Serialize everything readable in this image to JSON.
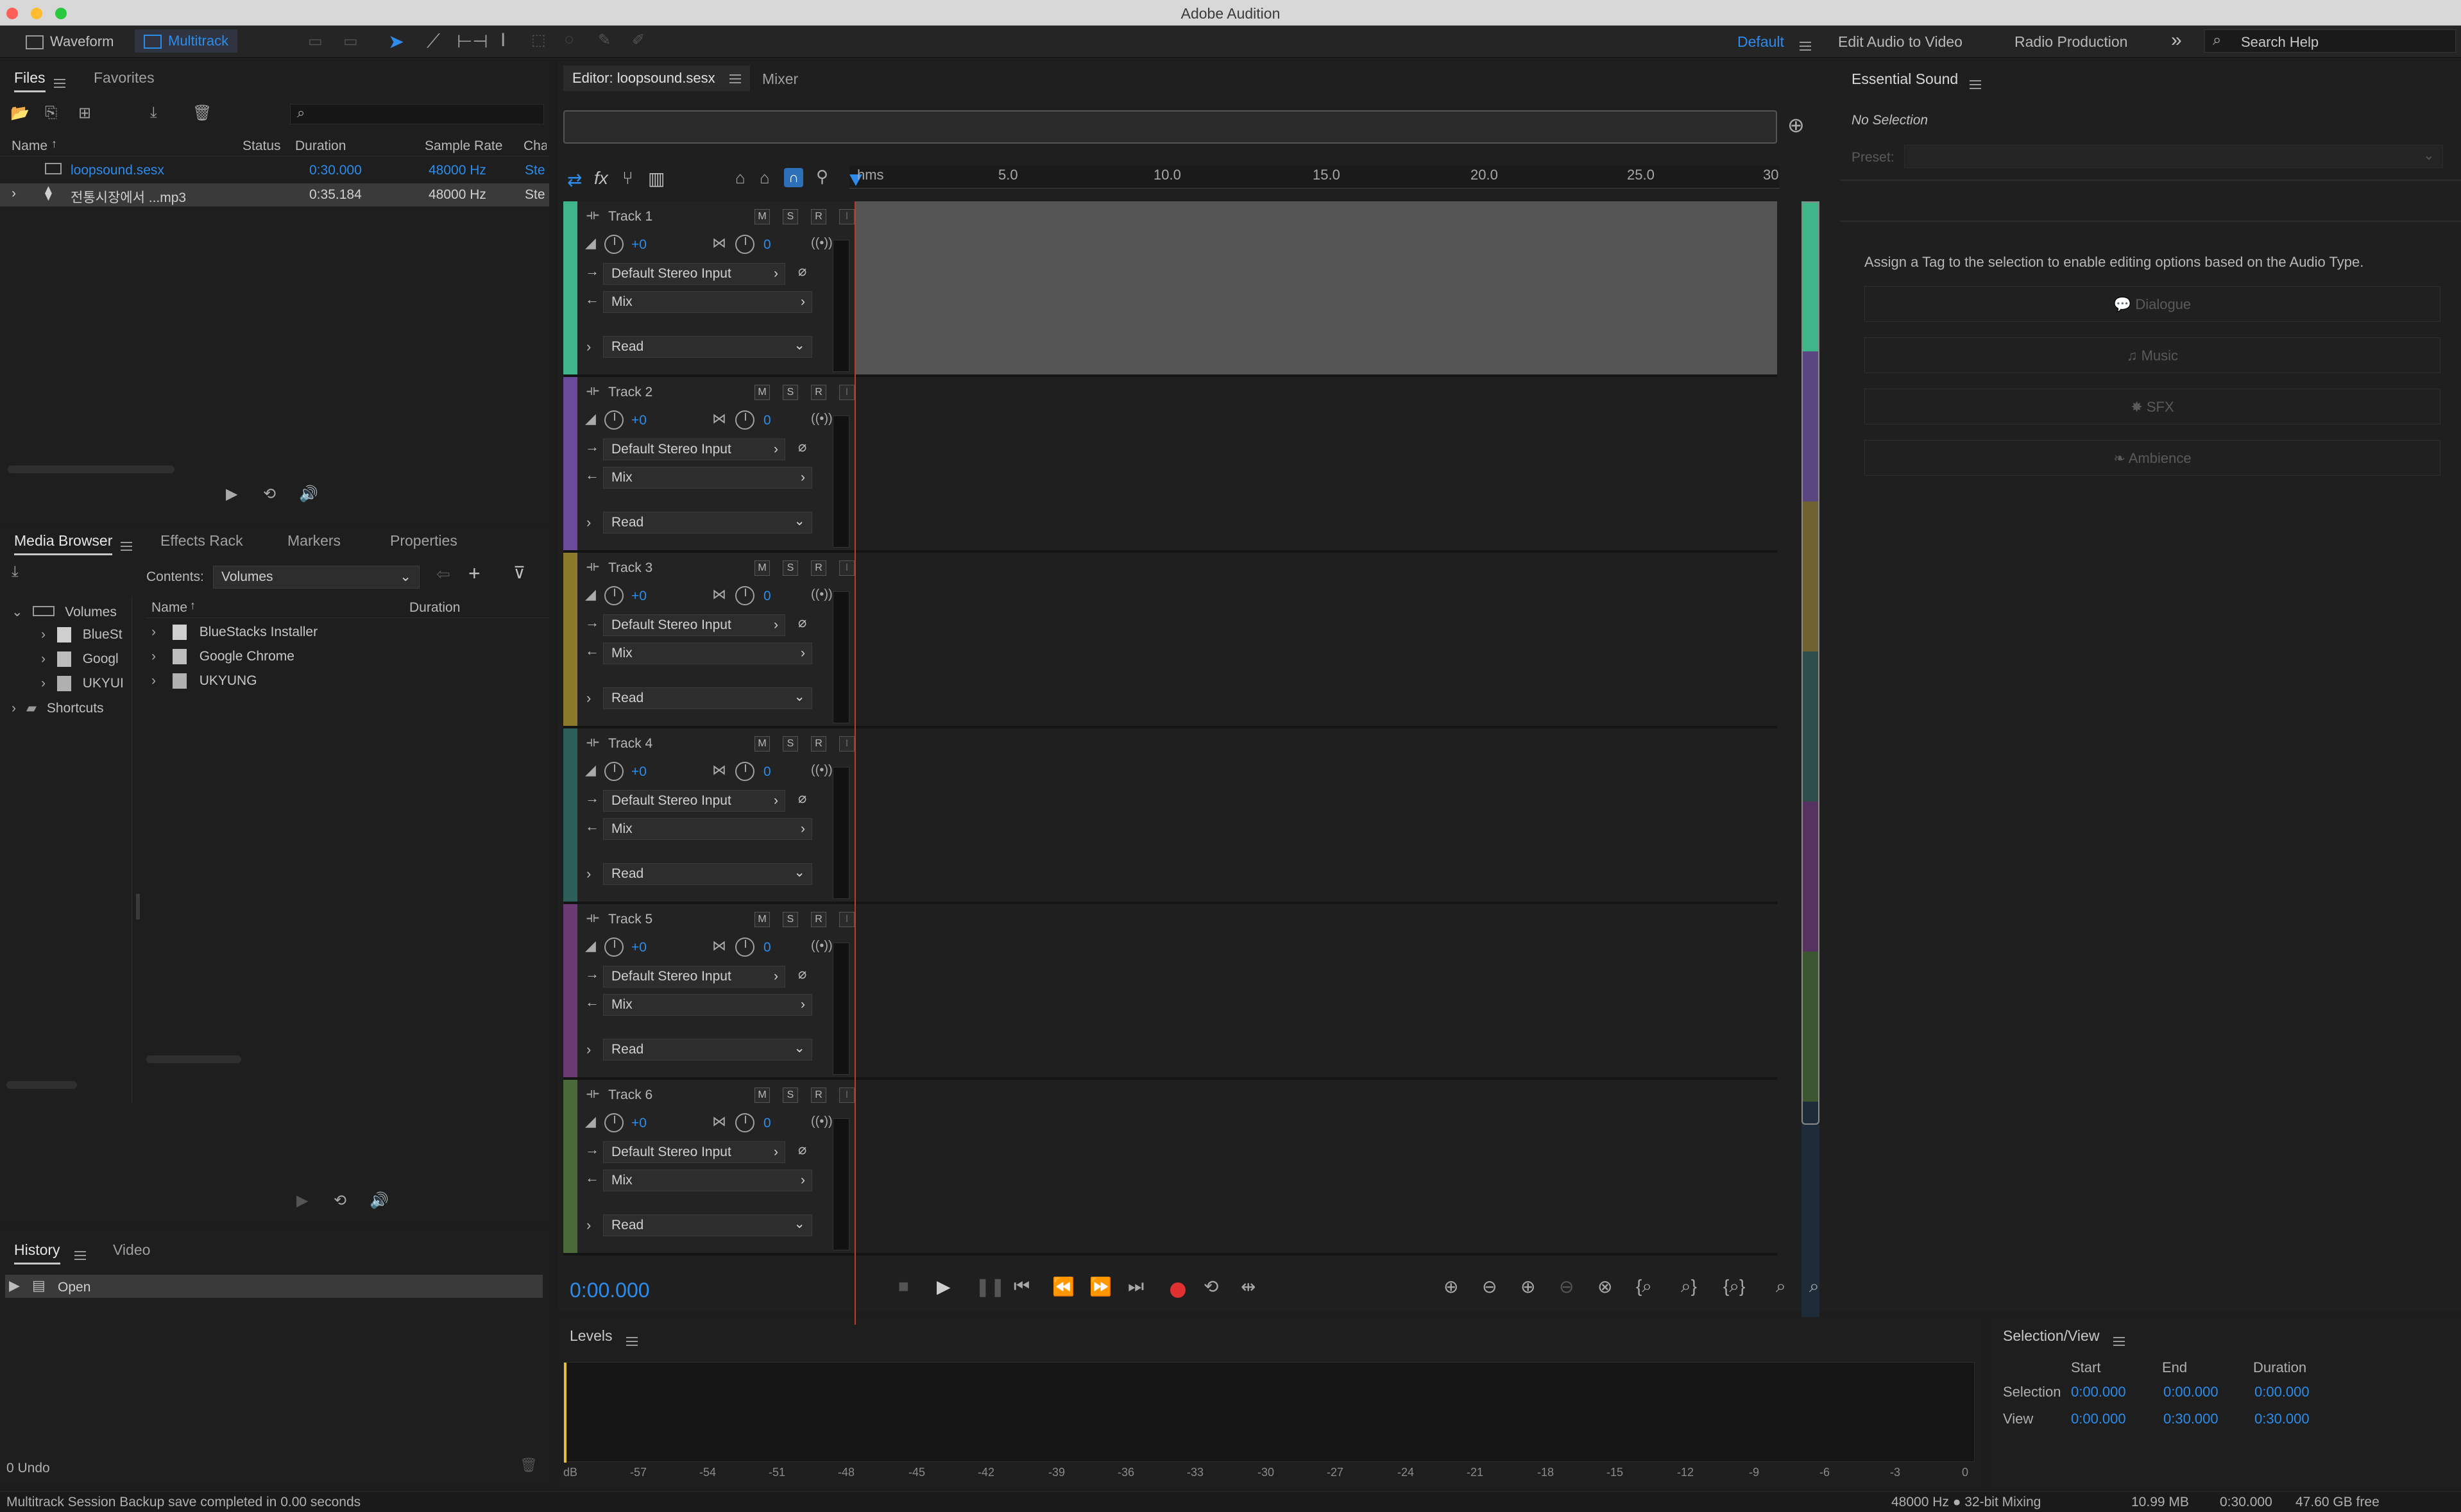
{
  "app": {
    "title": "Adobe Audition",
    "mode_waveform": "Waveform",
    "mode_multitrack": "Multitrack",
    "workspace_default": "Default",
    "workspace_edit_video": "Edit Audio to Video",
    "workspace_radio": "Radio Production",
    "search_placeholder": "Search Help"
  },
  "files": {
    "tab_files": "Files",
    "tab_favorites": "Favorites",
    "col_name": "Name",
    "col_status": "Status",
    "col_duration": "Duration",
    "col_rate": "Sample Rate",
    "col_ch": "Cha",
    "rows": [
      {
        "name": "loopsound.sesx",
        "duration": "0:30.000",
        "rate": "48000 Hz",
        "ch": "Ste"
      },
      {
        "name": "전통시장에서 ...mp3",
        "duration": "0:35.184",
        "rate": "48000 Hz",
        "ch": "Ste"
      }
    ]
  },
  "media": {
    "tab_media": "Media Browser",
    "tab_effects": "Effects Rack",
    "tab_markers": "Markers",
    "tab_properties": "Properties",
    "contents_label": "Contents:",
    "contents_value": "Volumes",
    "tree_volumes": "Volumes",
    "tree_items": [
      "BlueSt",
      "Googl",
      "UKYUI"
    ],
    "tree_shortcuts": "Shortcuts",
    "col_name": "Name",
    "col_duration": "Duration",
    "list": [
      "BlueStacks Installer",
      "Google Chrome",
      "UKYUNG"
    ]
  },
  "history": {
    "tab_history": "History",
    "tab_video": "Video",
    "item": "Open",
    "undo": "0 Undo"
  },
  "editor": {
    "tab_editor": "Editor: loopsound.sesx",
    "tab_mixer": "Mixer",
    "ruler": [
      "hms",
      "5.0",
      "10.0",
      "15.0",
      "20.0",
      "25.0",
      "30"
    ],
    "time": "0:00.000",
    "tracks": [
      {
        "name": "Track 1",
        "vol": "+0",
        "pan": "0",
        "input": "Default Stereo Input",
        "output": "Mix",
        "mode": "Read",
        "color": "#3fb58a"
      },
      {
        "name": "Track 2",
        "vol": "+0",
        "pan": "0",
        "input": "Default Stereo Input",
        "output": "Mix",
        "mode": "Read",
        "color": "#6a4a9a"
      },
      {
        "name": "Track 3",
        "vol": "+0",
        "pan": "0",
        "input": "Default Stereo Input",
        "output": "Mix",
        "mode": "Read",
        "color": "#8a7a2a"
      },
      {
        "name": "Track 4",
        "vol": "+0",
        "pan": "0",
        "input": "Default Stereo Input",
        "output": "Mix",
        "mode": "Read",
        "color": "#2e5e5a"
      },
      {
        "name": "Track 5",
        "vol": "+0",
        "pan": "0",
        "input": "Default Stereo Input",
        "output": "Mix",
        "mode": "Read",
        "color": "#6a3a72"
      },
      {
        "name": "Track 6",
        "vol": "+0",
        "pan": "0",
        "input": "Default Stereo Input",
        "output": "Mix",
        "mode": "Read",
        "color": "#4a6a3a"
      }
    ],
    "btn_m": "M",
    "btn_s": "S",
    "btn_r": "R",
    "btn_i": "I"
  },
  "essential": {
    "title": "Essential Sound",
    "no_selection": "No Selection",
    "preset_label": "Preset:",
    "assign_text": "Assign a Tag to the selection to enable editing options based on the Audio Type.",
    "types": [
      "Dialogue",
      "Music",
      "SFX",
      "Ambience"
    ]
  },
  "levels": {
    "title": "Levels",
    "scale": [
      "dB",
      "-57",
      "-54",
      "-51",
      "-48",
      "-45",
      "-42",
      "-39",
      "-36",
      "-33",
      "-30",
      "-27",
      "-24",
      "-21",
      "-18",
      "-15",
      "-12",
      "-9",
      "-6",
      "-3",
      "0"
    ]
  },
  "selection": {
    "title": "Selection/View",
    "col_start": "Start",
    "col_end": "End",
    "col_duration": "Duration",
    "row_selection": "Selection",
    "row_view": "View",
    "sel_start": "0:00.000",
    "sel_end": "0:00.000",
    "sel_duration": "0:00.000",
    "view_start": "0:00.000",
    "view_end": "0:30.000",
    "view_duration": "0:30.000"
  },
  "status": {
    "message": "Multitrack Session Backup save completed in 0.00 seconds",
    "format": "48000 Hz ● 32-bit Mixing",
    "size": "10.99 MB",
    "duration": "0:30.000",
    "free": "47.60 GB free"
  }
}
